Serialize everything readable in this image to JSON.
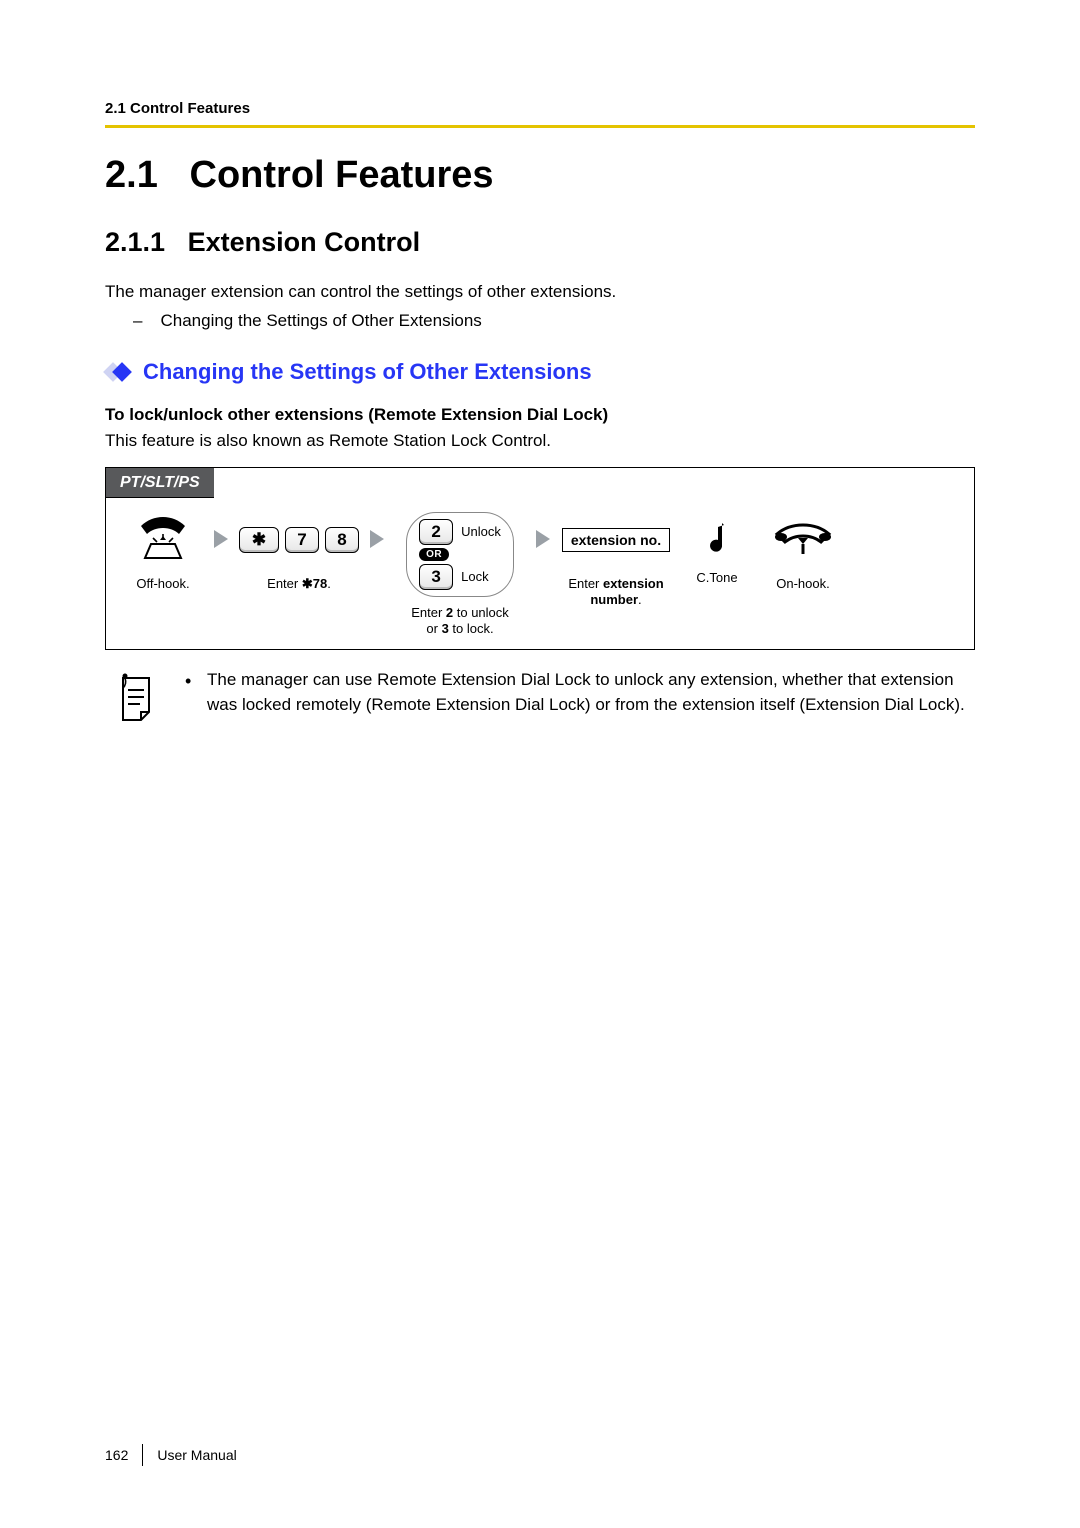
{
  "header": {
    "running": "2.1 Control Features"
  },
  "title": {
    "number": "2.1",
    "text": "Control Features"
  },
  "subsection": {
    "number": "2.1.1",
    "text": "Extension Control"
  },
  "intro": "The manager extension can control the settings of other extensions.",
  "dash_item": "Changing the Settings of Other Extensions",
  "sub_heading": "Changing the Settings of Other Extensions",
  "bold_line": "To lock/unlock other extensions (Remote Extension Dial Lock)",
  "note_line": "This feature is also known as Remote Station Lock Control.",
  "proc": {
    "tab": "PT/SLT/PS",
    "step1_cap": "Off-hook.",
    "keys": {
      "star": "✱",
      "k7": "7",
      "k8": "8"
    },
    "step2_cap_prefix": "Enter ",
    "step2_cap_bold": "✱78",
    "step2_cap_suffix": ".",
    "opt": {
      "two": "2",
      "two_label": "Unlock",
      "or": "OR",
      "three": "3",
      "three_label": "Lock"
    },
    "step3_cap_l1_a": "Enter ",
    "step3_cap_l1_b": "2",
    "step3_cap_l1_c": " to unlock",
    "step3_cap_l2_a": "or ",
    "step3_cap_l2_b": "3",
    "step3_cap_l2_c": " to lock.",
    "ext_box": "extension no.",
    "step4_cap_l1_a": "Enter ",
    "step4_cap_l1_b": "extension",
    "step4_cap_l2_a": "number",
    "step4_cap_l2_b": ".",
    "ctone": "C.Tone",
    "step5_cap": "On-hook."
  },
  "note_bullet": "The manager can use Remote Extension Dial Lock to unlock any extension, whether that extension was locked remotely (Remote Extension Dial Lock) or from the extension itself (Extension Dial Lock).",
  "footer": {
    "page": "162",
    "label": "User Manual"
  }
}
